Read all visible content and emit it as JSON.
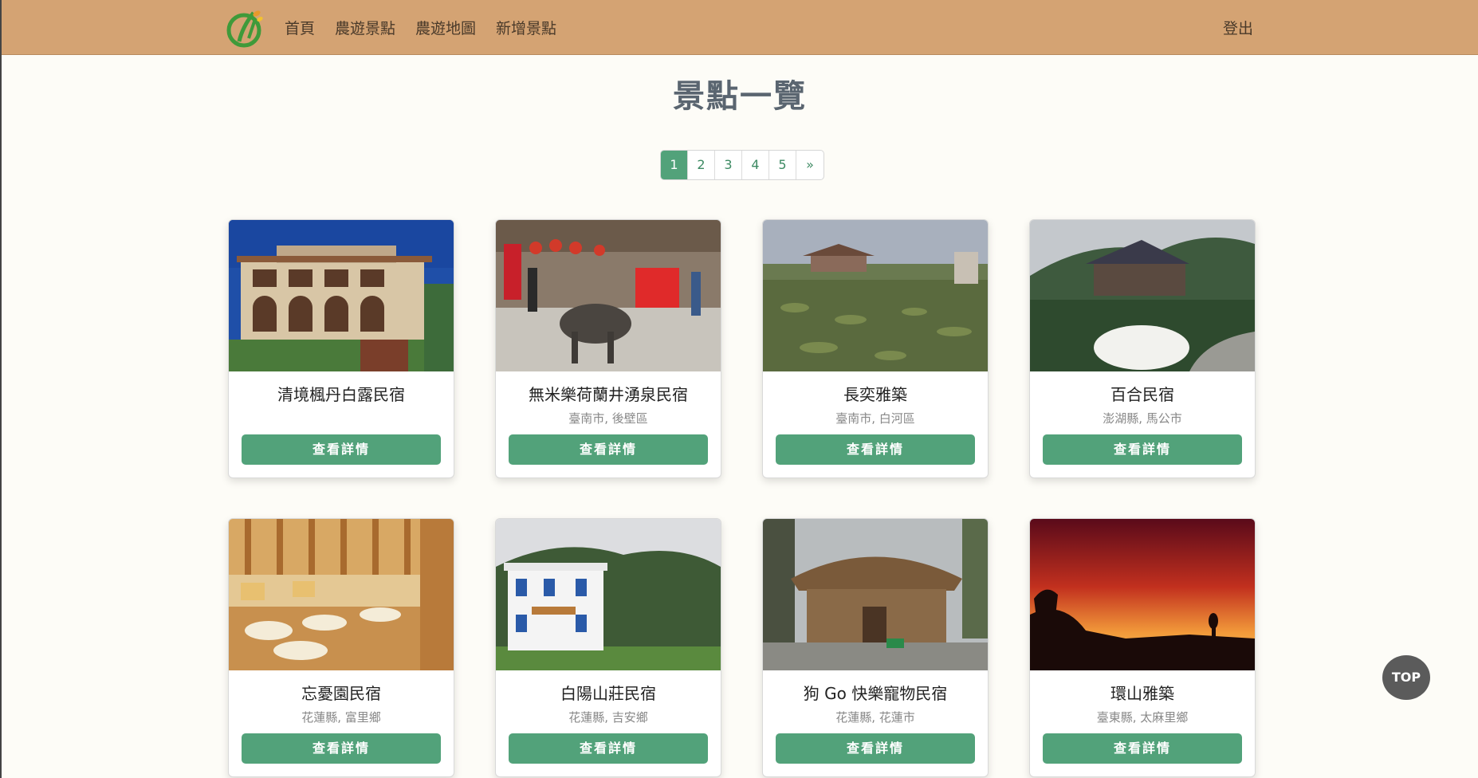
{
  "nav": {
    "logo_icon": "leaf-logo-icon",
    "links": [
      "首頁",
      "農遊景點",
      "農遊地圖",
      "新增景點"
    ],
    "logout": "登出"
  },
  "page_title": "景點一覽",
  "pagination": {
    "pages": [
      "1",
      "2",
      "3",
      "4",
      "5"
    ],
    "next": "»",
    "active": "1"
  },
  "cards": [
    {
      "title": "清境楓丹白露民宿",
      "location": "",
      "button": "查看詳情",
      "image": "european-villa-photo"
    },
    {
      "title": "無米樂荷蘭井湧泉民宿",
      "location": "臺南市, 後壁區",
      "button": "查看詳情",
      "image": "water-buffalo-cart-photo"
    },
    {
      "title": "長奕雅築",
      "location": "臺南市, 白河區",
      "button": "查看詳情",
      "image": "lotus-pond-photo"
    },
    {
      "title": "百合民宿",
      "location": "澎湖縣, 馬公市",
      "button": "查看詳情",
      "image": "mountain-house-photo"
    },
    {
      "title": "忘憂園民宿",
      "location": "花蓮縣, 富里鄉",
      "button": "查看詳情",
      "image": "bunk-room-photo"
    },
    {
      "title": "白陽山莊民宿",
      "location": "花蓮縣, 吉安鄉",
      "button": "查看詳情",
      "image": "white-villa-photo"
    },
    {
      "title": "狗 Go 快樂寵物民宿",
      "location": "花蓮縣, 花蓮市",
      "button": "查看詳情",
      "image": "thatched-hut-photo"
    },
    {
      "title": "環山雅築",
      "location": "臺東縣, 太麻里鄉",
      "button": "查看詳情",
      "image": "sunset-coast-photo"
    }
  ],
  "top_button": "TOP",
  "colors": {
    "navbar": "#d4a373",
    "accent": "#52a27a",
    "background": "#fdfcf7"
  }
}
